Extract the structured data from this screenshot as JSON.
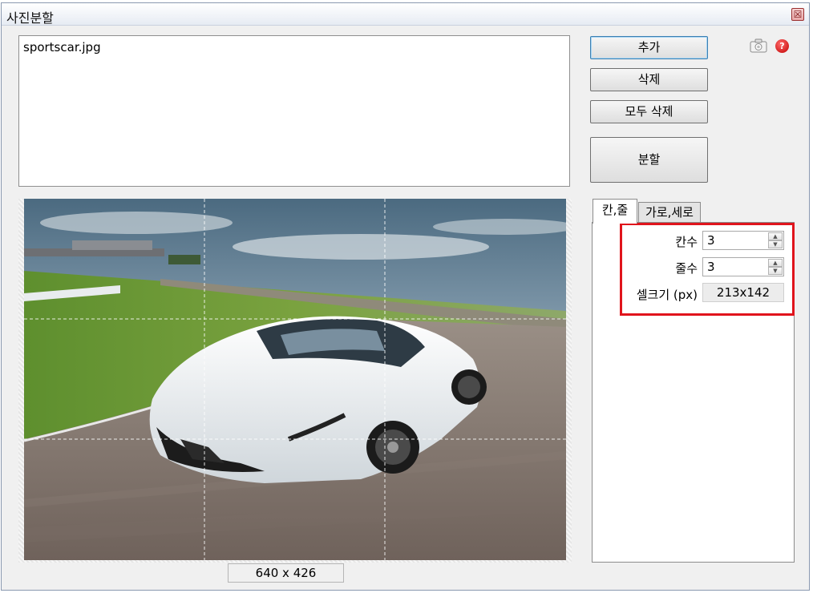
{
  "window": {
    "title": "사진분할",
    "close_glyph": "☒"
  },
  "file_list": {
    "items": [
      "sportscar.jpg"
    ]
  },
  "buttons": {
    "add": "추가",
    "delete": "삭제",
    "delete_all": "모두 삭제",
    "split": "분할"
  },
  "icons": {
    "camera": "camera-icon",
    "help": "help-icon",
    "help_glyph": "?"
  },
  "preview": {
    "image_size": "640 x 426",
    "grid_cols": 3,
    "grid_rows": 3
  },
  "tabs": [
    {
      "label": "칸,줄",
      "active": true
    },
    {
      "label": "가로,세로",
      "active": false
    }
  ],
  "settings": {
    "cols_label": "칸수",
    "cols_value": "3",
    "rows_label": "줄수",
    "rows_value": "3",
    "cell_size_label": "셀크기 (px)",
    "cell_size_value": "213x142"
  },
  "colors": {
    "highlight": "#e0141c",
    "window_bg": "#f0f0f0",
    "accent": "#3c7fb1"
  }
}
